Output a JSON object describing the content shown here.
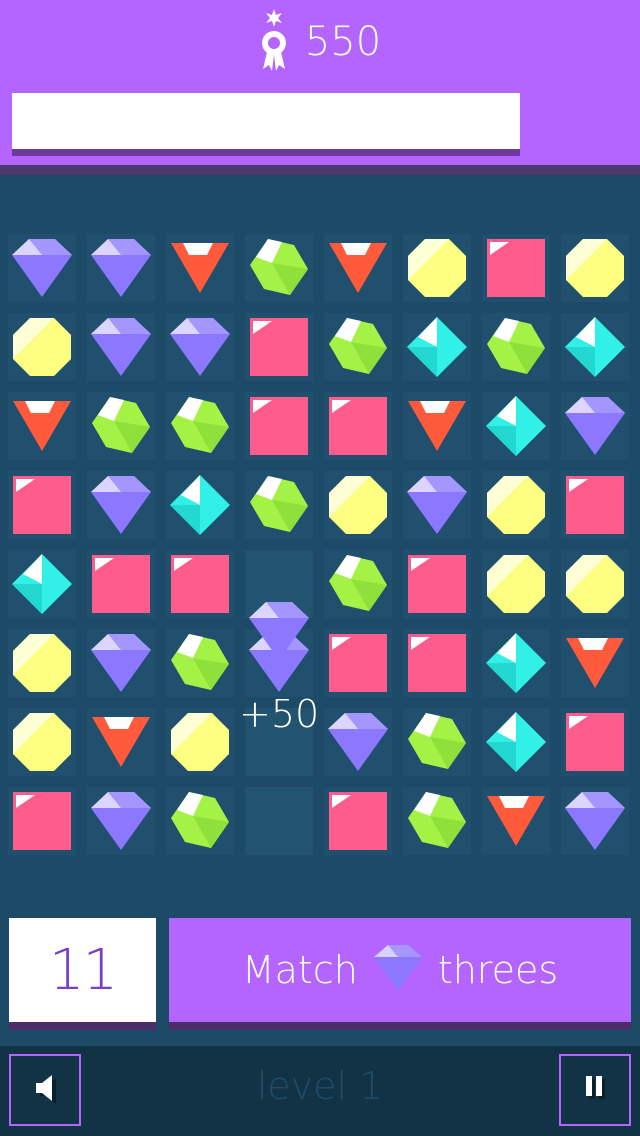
{
  "header": {
    "score": "550",
    "medal_icon": "medal-icon",
    "progress": 0.0
  },
  "board": {
    "cols": 8,
    "rows": 8,
    "cells": [
      [
        "purple",
        "purple",
        "red",
        "green",
        "red",
        "yellow",
        "pink",
        "yellow"
      ],
      [
        "yellow",
        "purple",
        "purple",
        "pink",
        "green",
        "cyan",
        "green",
        "cyan"
      ],
      [
        "red",
        "green",
        "green",
        "pink",
        "pink",
        "red",
        "cyan",
        "purple"
      ],
      [
        "pink",
        "purple",
        "cyan",
        "green",
        "yellow",
        "purple",
        "yellow",
        "pink"
      ],
      [
        "cyan",
        "pink",
        "pink",
        "empty",
        "green",
        "pink",
        "yellow",
        "yellow"
      ],
      [
        "yellow",
        "purple",
        "green",
        "purple",
        "pink",
        "pink",
        "cyan",
        "red"
      ],
      [
        "yellow",
        "red",
        "yellow",
        "text",
        "purple",
        "green",
        "cyan",
        "pink"
      ],
      [
        "pink",
        "purple",
        "green",
        "empty",
        "pink",
        "green",
        "red",
        "purple"
      ]
    ],
    "floating_score": "+50"
  },
  "goal": {
    "moves_left": "11",
    "match_label": "Match",
    "gem_icon": "purple-gem-icon",
    "threes_label": "threes"
  },
  "footer": {
    "level_label": "level 1",
    "sound_icon": "speaker-icon",
    "pause_icon": "pause-icon"
  },
  "colors": {
    "purple": "#8b78ff",
    "red": "#ff5a3c",
    "green": "#a4f245",
    "yellow": "#fcff80",
    "pink": "#ff5c8e",
    "cyan": "#30f0e8",
    "accent": "#b464ff"
  }
}
